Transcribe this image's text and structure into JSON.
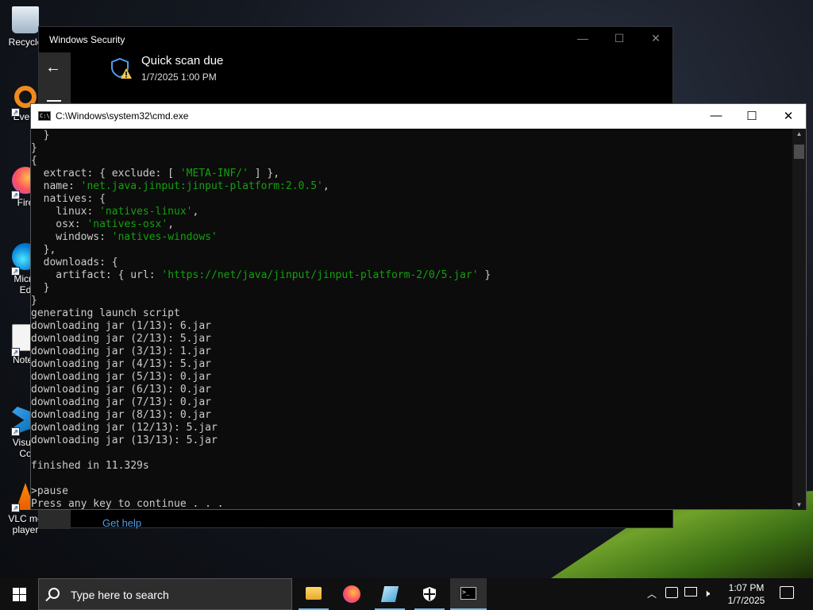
{
  "desktop": {
    "icons": [
      {
        "label": "Recycle",
        "icon": "recycle-bin-icon"
      },
      {
        "label": "Every",
        "icon": "everything-icon"
      },
      {
        "label": "Fire",
        "icon": "firefox-icon"
      },
      {
        "label": "Micro\nEd",
        "icon": "edge-icon"
      },
      {
        "label": "Notep",
        "icon": "notepad-plus-icon"
      },
      {
        "label": "Visual\nCo",
        "icon": "vscode-icon"
      },
      {
        "label": "VLC me\nplayer",
        "icon": "vlc-icon"
      }
    ]
  },
  "security_window": {
    "title": "Windows Security",
    "heading": "Quick scan due",
    "subtitle": "1/7/2025 1:00 PM",
    "help_link": "Get help"
  },
  "cmd_window": {
    "title": "C:\\Windows\\system32\\cmd.exe",
    "lines": [
      [
        {
          "t": "  }",
          "c": "p"
        }
      ],
      [
        {
          "t": "}",
          "c": "p"
        }
      ],
      [
        {
          "t": "{",
          "c": "p"
        }
      ],
      [
        {
          "t": "  extract: { exclude: [ ",
          "c": "p"
        },
        {
          "t": "'META-INF/'",
          "c": "s"
        },
        {
          "t": " ] },",
          "c": "p"
        }
      ],
      [
        {
          "t": "  name: ",
          "c": "p"
        },
        {
          "t": "'net.java.jinput:jinput-platform:2.0.5'",
          "c": "s"
        },
        {
          "t": ",",
          "c": "p"
        }
      ],
      [
        {
          "t": "  natives: {",
          "c": "p"
        }
      ],
      [
        {
          "t": "    linux: ",
          "c": "p"
        },
        {
          "t": "'natives-linux'",
          "c": "s"
        },
        {
          "t": ",",
          "c": "p"
        }
      ],
      [
        {
          "t": "    osx: ",
          "c": "p"
        },
        {
          "t": "'natives-osx'",
          "c": "s"
        },
        {
          "t": ",",
          "c": "p"
        }
      ],
      [
        {
          "t": "    windows: ",
          "c": "p"
        },
        {
          "t": "'natives-windows'",
          "c": "s"
        }
      ],
      [
        {
          "t": "  },",
          "c": "p"
        }
      ],
      [
        {
          "t": "  downloads: {",
          "c": "p"
        }
      ],
      [
        {
          "t": "    artifact: { url: ",
          "c": "p"
        },
        {
          "t": "'https://net/java/jinput/jinput-platform-2/0/5.jar'",
          "c": "s"
        },
        {
          "t": " }",
          "c": "p"
        }
      ],
      [
        {
          "t": "  }",
          "c": "p"
        }
      ],
      [
        {
          "t": "}",
          "c": "p"
        }
      ],
      [
        {
          "t": "generating launch script",
          "c": "p"
        }
      ],
      [
        {
          "t": "downloading jar (1/13): 6.jar",
          "c": "p"
        }
      ],
      [
        {
          "t": "downloading jar (2/13): 5.jar",
          "c": "p"
        }
      ],
      [
        {
          "t": "downloading jar (3/13): 1.jar",
          "c": "p"
        }
      ],
      [
        {
          "t": "downloading jar (4/13): 5.jar",
          "c": "p"
        }
      ],
      [
        {
          "t": "downloading jar (5/13): 0.jar",
          "c": "p"
        }
      ],
      [
        {
          "t": "downloading jar (6/13): 0.jar",
          "c": "p"
        }
      ],
      [
        {
          "t": "downloading jar (7/13): 0.jar",
          "c": "p"
        }
      ],
      [
        {
          "t": "downloading jar (8/13): 0.jar",
          "c": "p"
        }
      ],
      [
        {
          "t": "downloading jar (12/13): 5.jar",
          "c": "p"
        }
      ],
      [
        {
          "t": "downloading jar (13/13): 5.jar",
          "c": "p"
        }
      ],
      [
        {
          "t": "",
          "c": "p"
        }
      ],
      [
        {
          "t": "finished in 11.329s",
          "c": "p"
        }
      ],
      [
        {
          "t": "",
          "c": "p"
        }
      ],
      [
        {
          "t": ">pause",
          "c": "p"
        }
      ],
      [
        {
          "t": "Press any key to continue . . .",
          "c": "p"
        }
      ]
    ]
  },
  "taskbar": {
    "search_placeholder": "Type here to search",
    "apps": [
      "file-explorer-icon",
      "firefox-icon",
      "notepad-icon",
      "windows-security-icon",
      "cmd-icon"
    ],
    "time": "1:07 PM",
    "date": "1/7/2025"
  },
  "colors": {
    "console_text": "#cccccc",
    "console_string": "#13a10e",
    "link": "#4f9dea",
    "taskbar": "#101010"
  }
}
